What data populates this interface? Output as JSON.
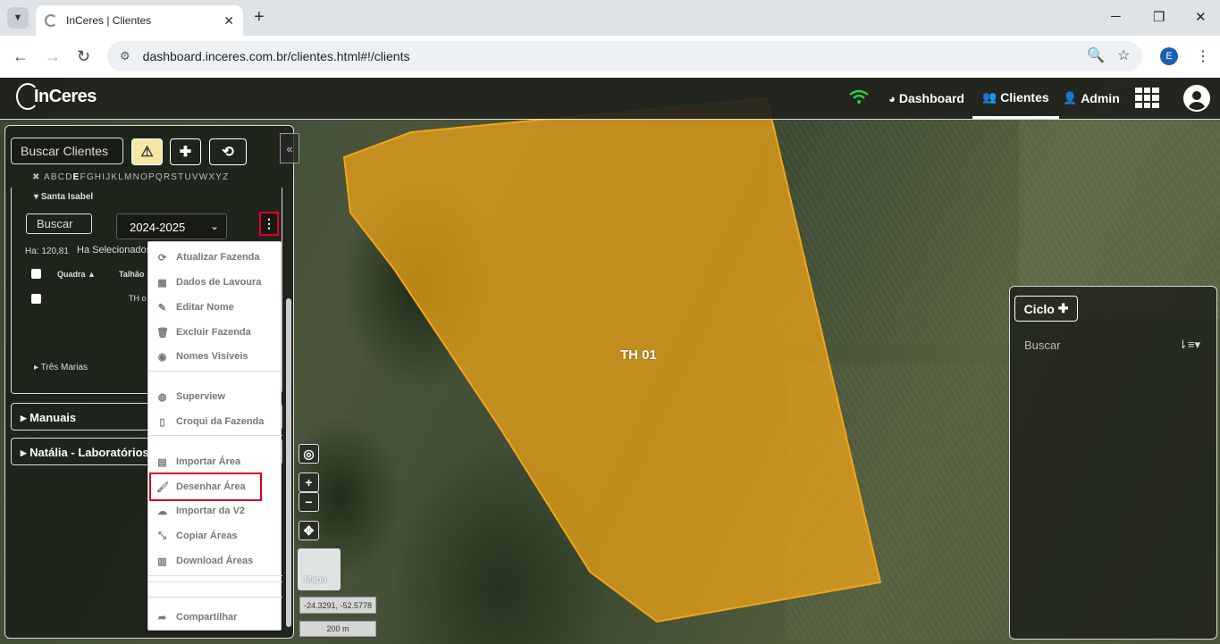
{
  "browser": {
    "tab_title": "InCeres | Clientes",
    "url": "dashboard.inceres.com.br/clientes.html#!/clients",
    "profile_initial": "E"
  },
  "app": {
    "logo_text": "InCeres",
    "nav": {
      "dashboard": "Dashboard",
      "clientes": "Clientes",
      "admin": "Admin"
    }
  },
  "sidebar": {
    "search_placeholder": "Buscar Clientes",
    "alphabet_clear": "✖",
    "letters": [
      "A",
      "B",
      "C",
      "D",
      "E",
      "F",
      "G",
      "H",
      "I",
      "J",
      "K",
      "L",
      "M",
      "N",
      "O",
      "P",
      "Q",
      "R",
      "S",
      "T",
      "U",
      "V",
      "W",
      "X",
      "Y",
      "Z"
    ],
    "active_letter": "E",
    "farm_open": "Santa Isabel",
    "farm_search": "Buscar",
    "season": "2024-2025",
    "ha_total": "Ha: 120,81",
    "ha_selected": "Ha Selecionados",
    "col_quadra": "Quadra",
    "col_talhao": "Talhão",
    "row_talhao": "TH o",
    "farm_closed": "Três Marias",
    "sections": [
      "Manuais",
      "Natália - Laboratórios"
    ]
  },
  "farm_menu": {
    "items": [
      {
        "label": "Atualizar Fazenda",
        "icon": "refresh-icon"
      },
      {
        "label": "Dados de Lavoura",
        "icon": "table-icon"
      },
      {
        "label": "Editar Nome",
        "icon": "pencil-icon"
      },
      {
        "label": "Excluir Fazenda",
        "icon": "trash-icon"
      },
      {
        "label": "Nomes Visíveis",
        "icon": "eye-icon"
      },
      {
        "label": "Superview",
        "icon": "superview-icon"
      },
      {
        "label": "Croqui da Fazenda",
        "icon": "map-icon"
      },
      {
        "label": "Importar Área",
        "icon": "file-import-icon"
      },
      {
        "label": "Desenhar Área",
        "icon": "brush-icon"
      },
      {
        "label": "Importar da V2",
        "icon": "cloud-upload-icon"
      },
      {
        "label": "Copiar Áreas",
        "icon": "compress-icon"
      },
      {
        "label": "Download Áreas",
        "icon": "file-download-icon"
      },
      {
        "label": "Compartilhar",
        "icon": "share-icon"
      }
    ],
    "selected_index": 8
  },
  "map": {
    "polygon_label": "TH 01",
    "basemap_label": "Mapa",
    "coordinates": "-24.3291, -52.5778",
    "scale": "200 m",
    "polygon_color": "#f2a616"
  },
  "right_panel": {
    "ciclo_label": "Ciclo",
    "search_placeholder": "Buscar"
  }
}
